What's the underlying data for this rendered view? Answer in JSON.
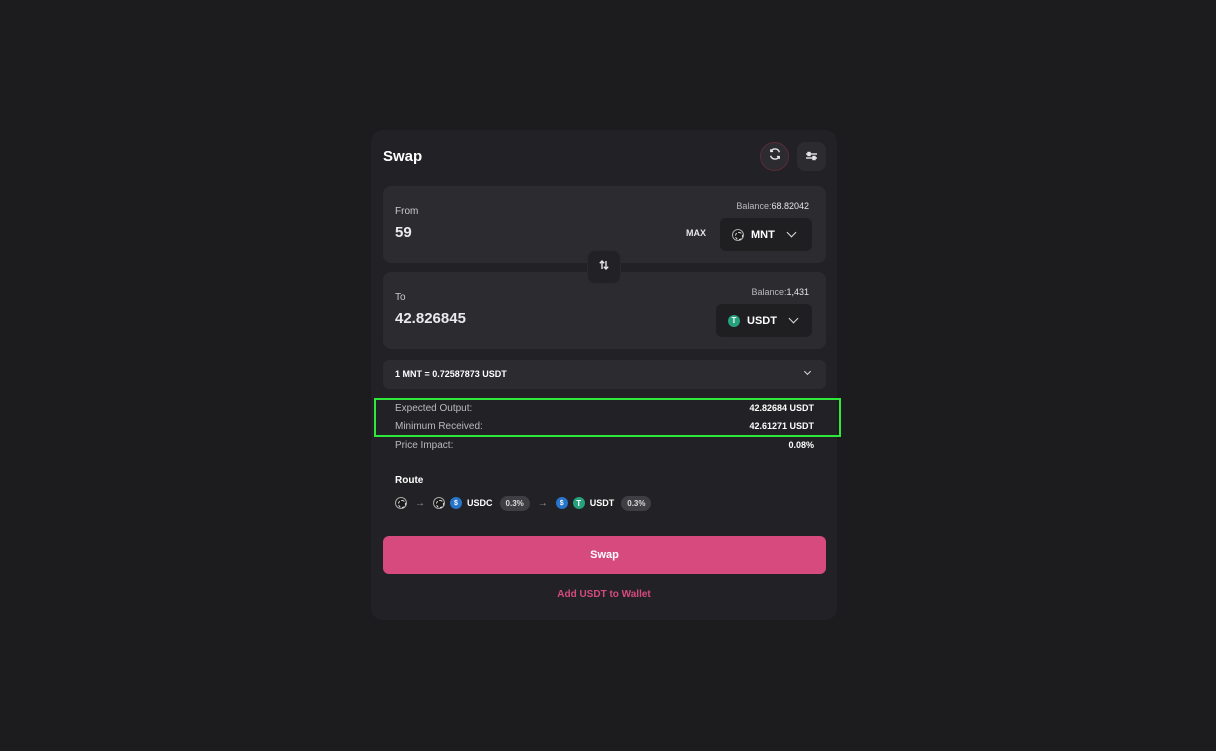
{
  "swap": {
    "title": "Swap",
    "icons": {
      "refresh": "refresh-icon",
      "settings": "settings-sliders-icon",
      "switch": "swap-vertical-icon"
    },
    "from": {
      "label": "From",
      "amount": "59",
      "balance_label": "Balance:",
      "balance_value": "68.82042",
      "max_label": "MAX",
      "token": "MNT"
    },
    "to": {
      "label": "To",
      "amount": "42.826845",
      "balance_label": "Balance:",
      "balance_value": "1,431",
      "token": "USDT"
    },
    "rate": "1 MNT = 0.72587873 USDT",
    "details": {
      "expected_output_label": "Expected Output:",
      "expected_output_value": "42.82684 USDT",
      "minimum_received_label": "Minimum Received:",
      "minimum_received_value": "42.61271 USDT",
      "price_impact_label": "Price Impact:",
      "price_impact_value": "0.08%"
    },
    "route": {
      "title": "Route",
      "hops": [
        {
          "token": "USDC",
          "fee": "0.3%"
        },
        {
          "token": "USDT",
          "fee": "0.3%"
        }
      ]
    },
    "swap_button": "Swap",
    "add_wallet_link": "Add USDT to Wallet"
  },
  "colors": {
    "background": "#1c1c1e",
    "card": "#222226",
    "panel": "#2b2b30",
    "accent": "#d64a7e",
    "highlight": "#2ee83a",
    "usdt": "#26a17b",
    "usdc": "#2775ca"
  }
}
